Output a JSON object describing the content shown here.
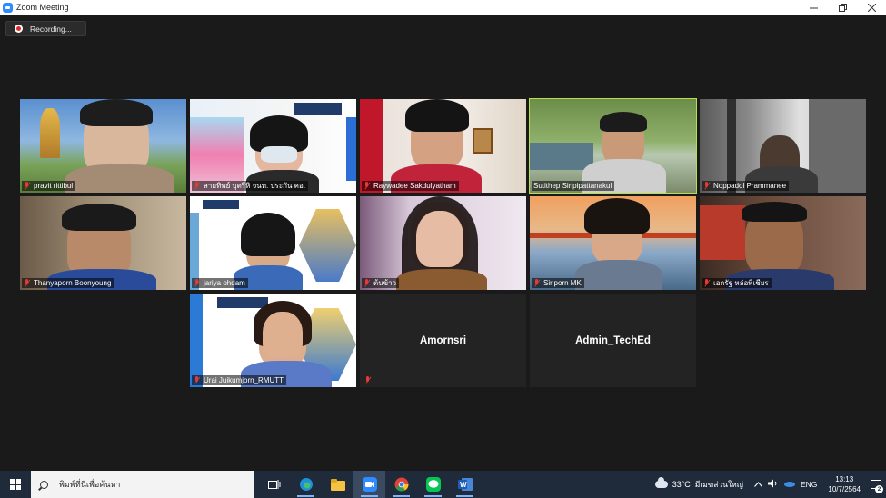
{
  "window": {
    "title": "Zoom Meeting",
    "minimize_icon": "minimize-icon",
    "restore_icon": "restore-icon",
    "close_icon": "close-icon"
  },
  "recording": {
    "label": "Recording..."
  },
  "participants": [
    {
      "name": "pravit rittibul",
      "muted": true,
      "video": true,
      "active": false
    },
    {
      "name": "สายทิพย์ บุตรีหิ จนท. ประกัน คอ.",
      "muted": true,
      "video": true,
      "active": false
    },
    {
      "name": "Raywadee Sakdulyatham",
      "muted": true,
      "video": true,
      "active": false
    },
    {
      "name": "Sutithep Siripipattanakul",
      "muted": false,
      "video": true,
      "active": true
    },
    {
      "name": "Noppadol Prammanee",
      "muted": true,
      "video": true,
      "active": false
    },
    {
      "name": "Thanyaporn Boonyoung",
      "muted": true,
      "video": true,
      "active": false
    },
    {
      "name": "jariya ohdam",
      "muted": true,
      "video": true,
      "active": false
    },
    {
      "name": "ต้นข้าว",
      "muted": true,
      "video": true,
      "active": false
    },
    {
      "name": "Siriporn MK",
      "muted": true,
      "video": true,
      "active": false
    },
    {
      "name": "เอกรัฐ หล่อพิเชียร",
      "muted": true,
      "video": true,
      "active": false
    },
    {
      "name": "Urai Juikumjorn_RMUTT",
      "muted": true,
      "video": true,
      "active": false
    },
    {
      "name": "Amornsri",
      "muted": true,
      "video": false,
      "active": false
    },
    {
      "name": "Admin_TechEd",
      "muted": false,
      "video": false,
      "active": false
    }
  ],
  "taskbar": {
    "search_placeholder": "พิมพ์ที่นี่เพื่อค้นหา",
    "apps": [
      "task-view-icon",
      "edge-icon",
      "file-explorer-icon",
      "zoom-icon",
      "chrome-icon",
      "line-icon",
      "word-icon"
    ],
    "weather_temp": "33°C",
    "weather_place": "มีเมฆส่วนใหญ่",
    "language": "ENG",
    "time": "13:13",
    "date": "10/7/2564",
    "notification_count": "2"
  }
}
